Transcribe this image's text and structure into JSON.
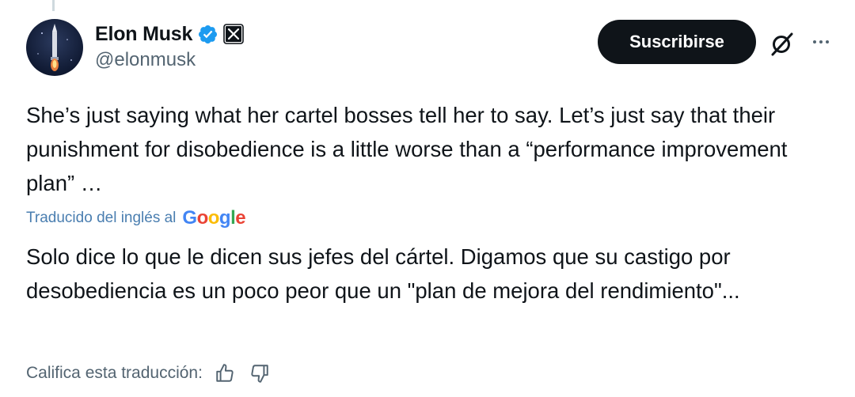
{
  "author": {
    "display_name": "Elon Musk",
    "handle": "@elonmusk",
    "verified_icon": "verified-badge-icon",
    "affiliation_icon": "x-logo-icon"
  },
  "actions": {
    "subscribe_label": "Suscribirse",
    "grok_icon": "grok-icon",
    "more_icon": "more-options-icon"
  },
  "tweet": {
    "text": "She’s just saying what her cartel bosses tell her to say. Let’s just say that their punishment for disobedience is a little worse than a “performance improvement plan” …"
  },
  "translation": {
    "label": "Traducido del inglés al",
    "provider_letters": [
      "G",
      "o",
      "o",
      "g",
      "l",
      "e"
    ],
    "text": "Solo dice lo que le dicen sus jefes del cártel. Digamos que su castigo por desobediencia es un poco peor que un \"plan de mejora del rendimiento\"...",
    "rate_label": "Califica esta traducción:"
  },
  "colors": {
    "subscribe_bg": "#0f1419",
    "verified_blue": "#1d9bf0",
    "link_blue": "#4a7eb0",
    "secondary_text": "#536471"
  }
}
